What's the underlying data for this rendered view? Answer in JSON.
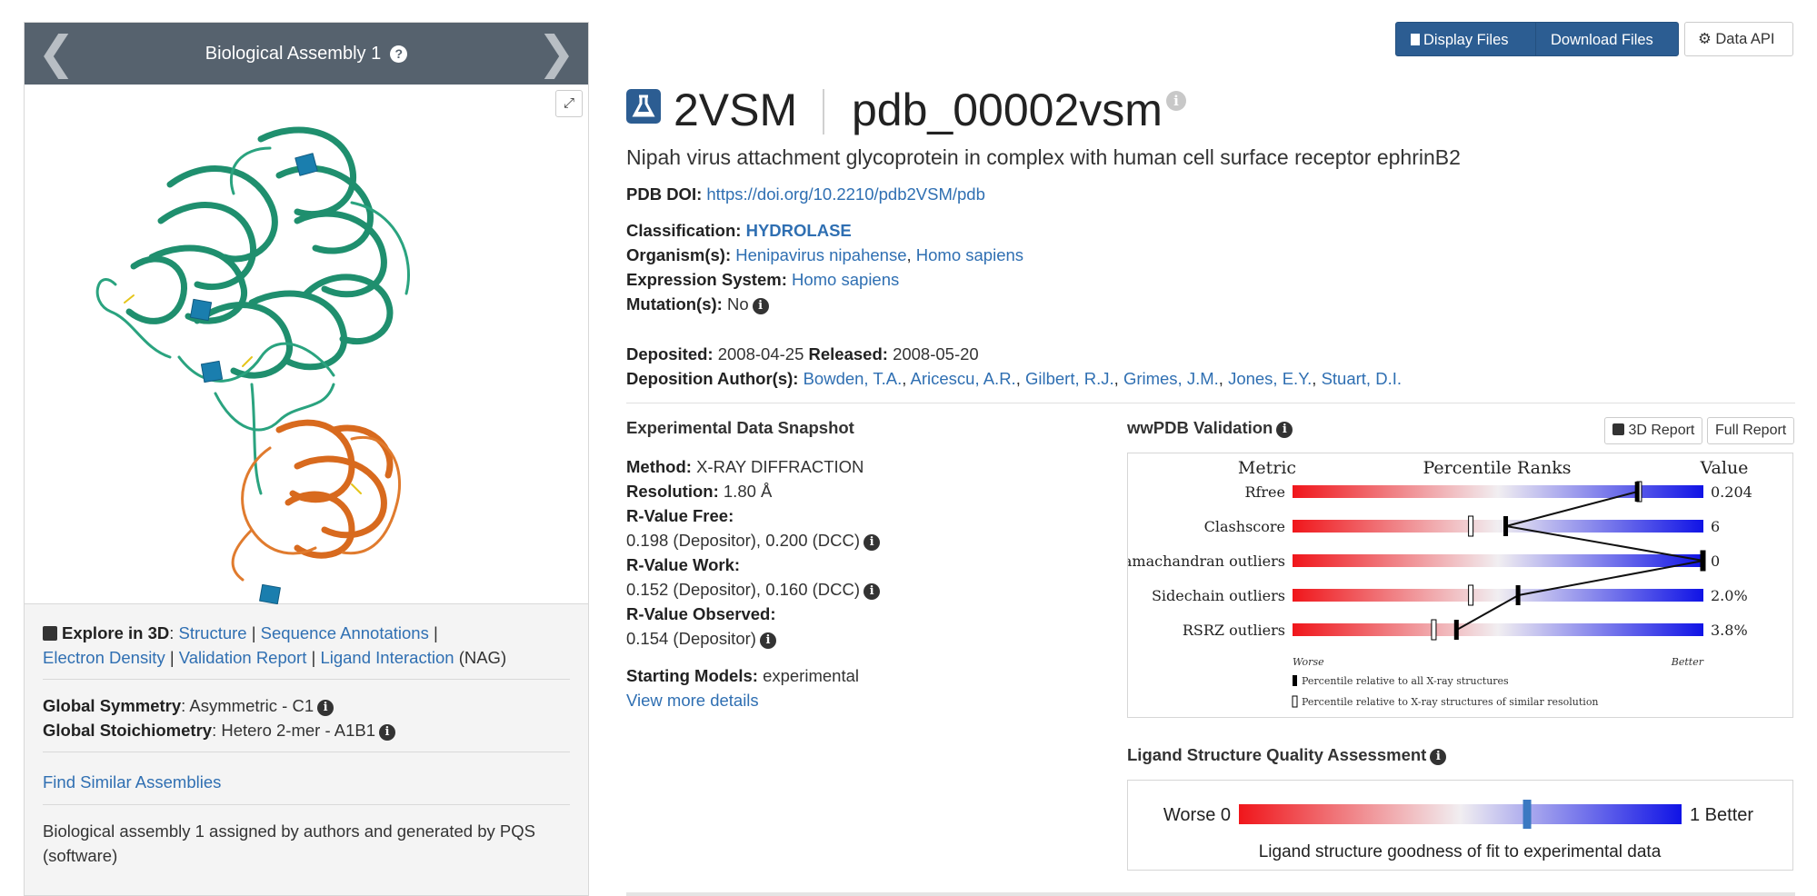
{
  "assembly": {
    "title": "Biological Assembly 1",
    "help_icon": "question-circle-icon",
    "prev_icon": "chevron-left-icon",
    "next_icon": "chevron-right-icon",
    "expand_icon": "expand-icon"
  },
  "explore": {
    "label": "Explore in 3D",
    "colon": ":",
    "links": [
      "Structure",
      "Sequence Annotations",
      "Electron Density",
      "Validation Report",
      "Ligand Interaction"
    ],
    "ligand_suffix": "(NAG)",
    "pipe": "|"
  },
  "symmetry": {
    "global_symmetry_label": "Global Symmetry",
    "global_symmetry_value": ": Asymmetric - C1",
    "global_stoich_label": "Global Stoichiometry",
    "global_stoich_value": ": Hetero 2-mer - A1B1"
  },
  "find_similar": "Find Similar Assemblies",
  "assembly_note": "Biological assembly 1 assigned by authors and generated by PQS (software)",
  "toolbar": {
    "display_files": "Display Files",
    "download_files": "Download Files",
    "data_api": "Data API"
  },
  "entry": {
    "id": "2VSM",
    "pdb_id": "pdb_00002vsm",
    "title": "Nipah virus attachment glycoprotein in complex with human cell surface receptor ephrinB2",
    "doi_label": "PDB DOI:",
    "doi": "https://doi.org/10.2210/pdb2VSM/pdb",
    "classification_label": "Classification:",
    "classification": "HYDROLASE",
    "organism_label": "Organism(s):",
    "organism_1": "Henipavirus nipahense",
    "organism_2": "Homo sapiens",
    "expression_label": "Expression System:",
    "expression": "Homo sapiens",
    "mutation_label": "Mutation(s):",
    "mutation": "No",
    "deposited_label": "Deposited:",
    "deposited": "2008-04-25",
    "released_label": "Released:",
    "released": "2008-05-20",
    "authors_label": "Deposition Author(s):",
    "authors": [
      "Bowden, T.A.",
      "Aricescu, A.R.",
      "Gilbert, R.J.",
      "Grimes, J.M.",
      "Jones, E.Y.",
      "Stuart, D.I."
    ]
  },
  "experimental": {
    "heading": "Experimental Data Snapshot",
    "method_label": "Method:",
    "method": "X-RAY DIFFRACTION",
    "resolution_label": "Resolution:",
    "resolution": "1.80 Å",
    "rfree_label": "R-Value Free:",
    "rfree": "0.198 (Depositor), 0.200 (DCC)",
    "rwork_label": "R-Value Work:",
    "rwork": "0.152 (Depositor), 0.160 (DCC)",
    "robs_label": "R-Value Observed:",
    "robs": "0.154 (Depositor)",
    "starting_label": "Starting Models:",
    "starting": "experimental",
    "view_more": "View more details"
  },
  "validation": {
    "heading": "wwPDB Validation",
    "report_3d": "3D Report",
    "full_report": "Full Report",
    "col_metric": "Metric",
    "col_percentile": "Percentile Ranks",
    "col_value": "Value",
    "worse": "Worse",
    "better": "Better",
    "legend_all": "Percentile relative to all X-ray structures",
    "legend_similar": "Percentile relative to X-ray structures of similar resolution",
    "metrics": [
      {
        "name": "Rfree",
        "value": "0.204",
        "all": 0.84,
        "similar": 0.845
      },
      {
        "name": "Clashscore",
        "value": "6",
        "all": 0.52,
        "similar": 0.435
      },
      {
        "name": "Ramachandran outliers",
        "value": "0",
        "all": 1.0,
        "similar": 1.0
      },
      {
        "name": "Sidechain outliers",
        "value": "2.0%",
        "all": 0.55,
        "similar": 0.435
      },
      {
        "name": "RSRZ outliers",
        "value": "3.8%",
        "all": 0.4,
        "similar": 0.345
      }
    ]
  },
  "ligand": {
    "heading": "Ligand Structure Quality Assessment",
    "worse": "Worse 0",
    "better": "1 Better",
    "caption": "Ligand structure goodness of fit to experimental data",
    "score": 0.65
  },
  "colors": {
    "accent": "#2c5d92",
    "link": "#2f6fb2",
    "header_bg": "#56626e",
    "protein_chain_a": "#1f8f6e",
    "protein_chain_b": "#d86a1e",
    "glycan": "#1a7eae"
  }
}
